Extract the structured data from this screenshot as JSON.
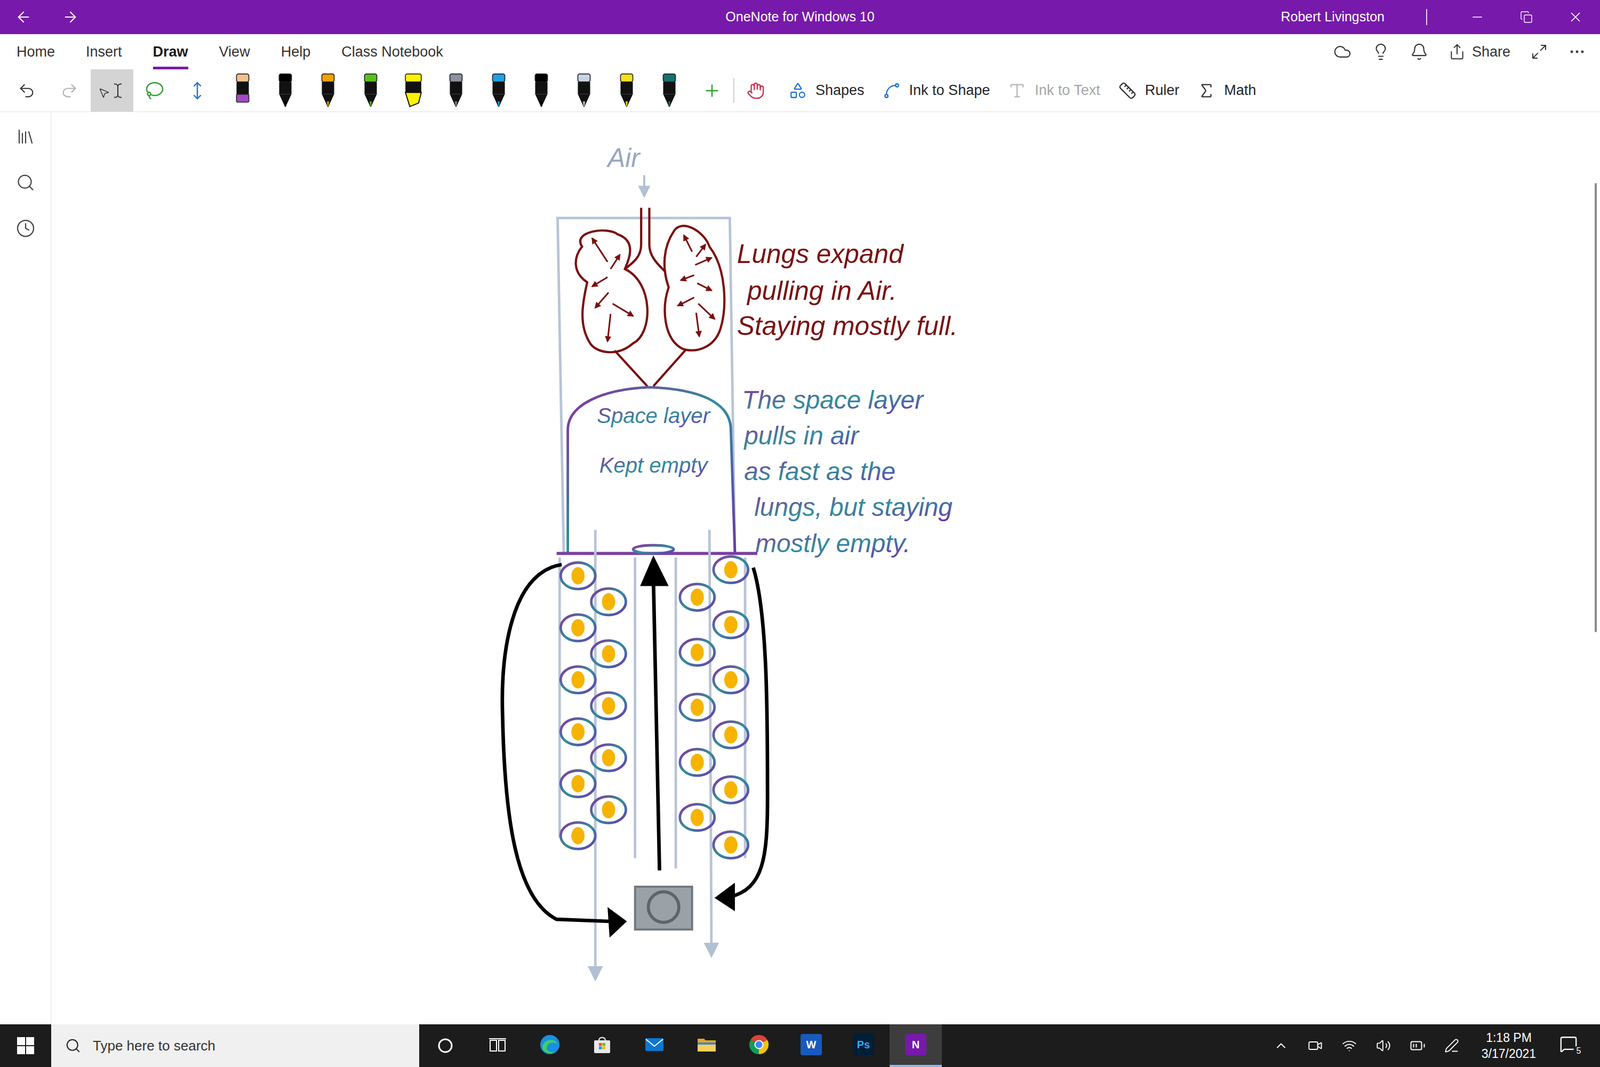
{
  "window": {
    "title": "OneNote for Windows 10",
    "user": "Robert Livingston"
  },
  "menu_tabs": [
    {
      "label": "Home",
      "selected": false
    },
    {
      "label": "Insert",
      "selected": false
    },
    {
      "label": "Draw",
      "selected": true
    },
    {
      "label": "View",
      "selected": false
    },
    {
      "label": "Help",
      "selected": false
    },
    {
      "label": "Class Notebook",
      "selected": false
    }
  ],
  "share": {
    "label": "Share"
  },
  "toolbar": {
    "history": {
      "undo_disabled": false,
      "redo_disabled": true
    },
    "tools": [
      {
        "kind": "type",
        "selected": true
      },
      {
        "kind": "lasso",
        "selected": false
      },
      {
        "kind": "space",
        "selected": false
      }
    ],
    "pens": [
      {
        "kind": "pencil",
        "color": "#a24bc4"
      },
      {
        "kind": "pen",
        "color": "#000000"
      },
      {
        "kind": "pen",
        "color": "#f2a100"
      },
      {
        "kind": "pen",
        "color": "#58c21a"
      },
      {
        "kind": "highlighter",
        "color": "#fff200"
      },
      {
        "kind": "pen",
        "color": "#8d939c"
      },
      {
        "kind": "pen",
        "color": "#1ea0e6"
      },
      {
        "kind": "pen",
        "color": "#000000"
      },
      {
        "kind": "pen",
        "color": "#c9d2e3"
      },
      {
        "kind": "pen",
        "color": "#f4e11c"
      },
      {
        "kind": "pen",
        "color": "#17706f"
      }
    ],
    "buttons": [
      {
        "kind": "shapes",
        "label": "Shapes",
        "disabled": false
      },
      {
        "kind": "ink-to-shape",
        "label": "Ink to Shape",
        "disabled": false
      },
      {
        "kind": "ink-to-text",
        "label": "Ink to Text",
        "disabled": true
      },
      {
        "kind": "ruler",
        "label": "Ruler",
        "disabled": false
      },
      {
        "kind": "math",
        "label": "Math",
        "disabled": false
      }
    ]
  },
  "canvas": {
    "air_label": "Air",
    "lungs_note": [
      "Lungs expand",
      "pulling in Air.",
      "Staying mostly full."
    ],
    "space_layer_label": [
      "Space layer",
      "Kept empty"
    ],
    "space_note": [
      "The space layer",
      "pulls in air",
      "as fast as the",
      "lungs, but staying",
      "mostly empty."
    ]
  },
  "taskbar": {
    "search_placeholder": "Type here to search",
    "apps": [
      {
        "kind": "edge",
        "active": false
      },
      {
        "kind": "store",
        "active": false
      },
      {
        "kind": "mail",
        "active": false
      },
      {
        "kind": "explorer",
        "active": false
      },
      {
        "kind": "chrome",
        "active": false
      },
      {
        "kind": "word",
        "glyph": "W",
        "active": false
      },
      {
        "kind": "photoshop",
        "glyph": "Ps",
        "active": false
      },
      {
        "kind": "onenote",
        "glyph": "N",
        "active": true
      }
    ],
    "time": "1:18 PM",
    "date": "3/17/2021",
    "notifications": "5"
  }
}
